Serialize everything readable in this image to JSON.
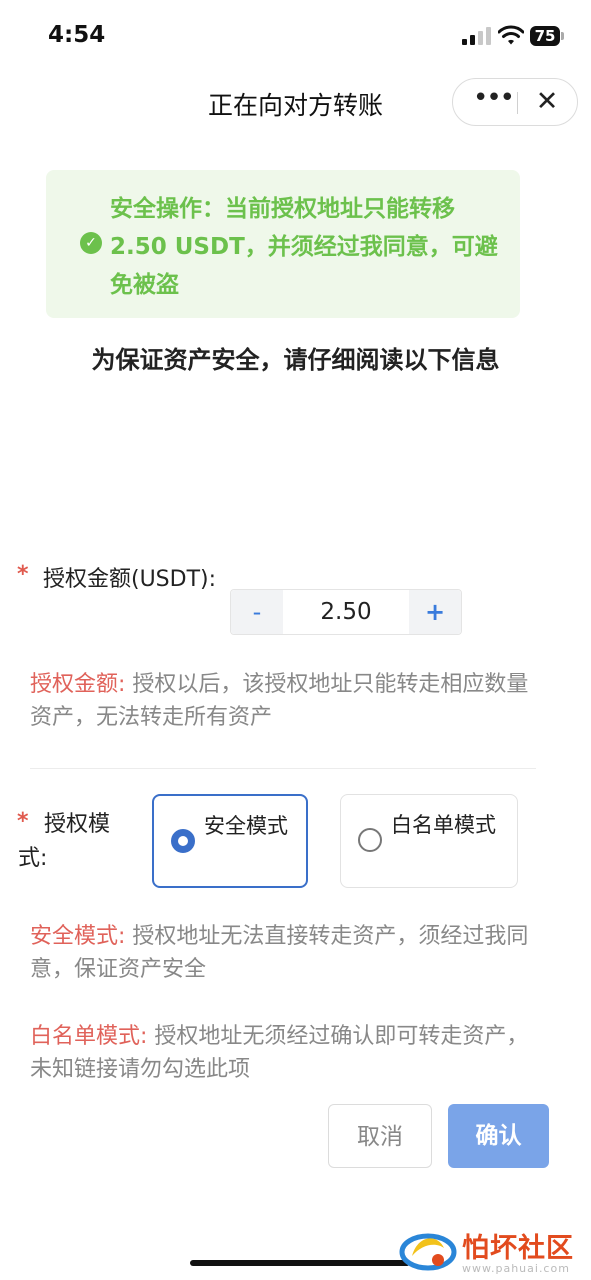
{
  "status_bar": {
    "time": "4:54",
    "battery": "75"
  },
  "header": {
    "title": "正在向对方转账",
    "more_icon": "more-dots-icon",
    "close_icon": "close-icon"
  },
  "notice": {
    "icon": "check-circle-icon",
    "text": "安全操作：当前授权地址只能转移2.50 USDT，并须经过我同意，可避免被盗",
    "color": "#6cc14c"
  },
  "read_note": "为保证资产安全，请仔细阅读以下信息",
  "amount": {
    "required_mark": "*",
    "label": "授权金额(USDT):",
    "minus": "-",
    "value": "2.50",
    "plus": "+",
    "desc_title": "授权金额:",
    "desc_text": " 授权以后，该授权地址只能转走相应数量资产，无法转走所有资产"
  },
  "mode": {
    "required_mark": "*",
    "label": "授权模式:",
    "options": [
      {
        "label": "安全模式",
        "selected": true
      },
      {
        "label": "白名单模式",
        "selected": false
      }
    ],
    "safe_desc_title": "安全模式:",
    "safe_desc_text": " 授权地址无法直接转走资产，须经过我同意，保证资产安全",
    "white_desc_title": "白名单模式:",
    "white_desc_text": " 授权地址无须经过确认即可转走资产，未知链接请勿勾选此项"
  },
  "actions": {
    "cancel": "取消",
    "confirm": "确认"
  },
  "watermark": {
    "name": "怕坏社区",
    "url": "www.pahuai.com"
  },
  "colors": {
    "accent": "#3a6fc9",
    "warning": "#e0625a",
    "success": "#6cc14c",
    "confirm_bg": "#7aa4e8"
  }
}
